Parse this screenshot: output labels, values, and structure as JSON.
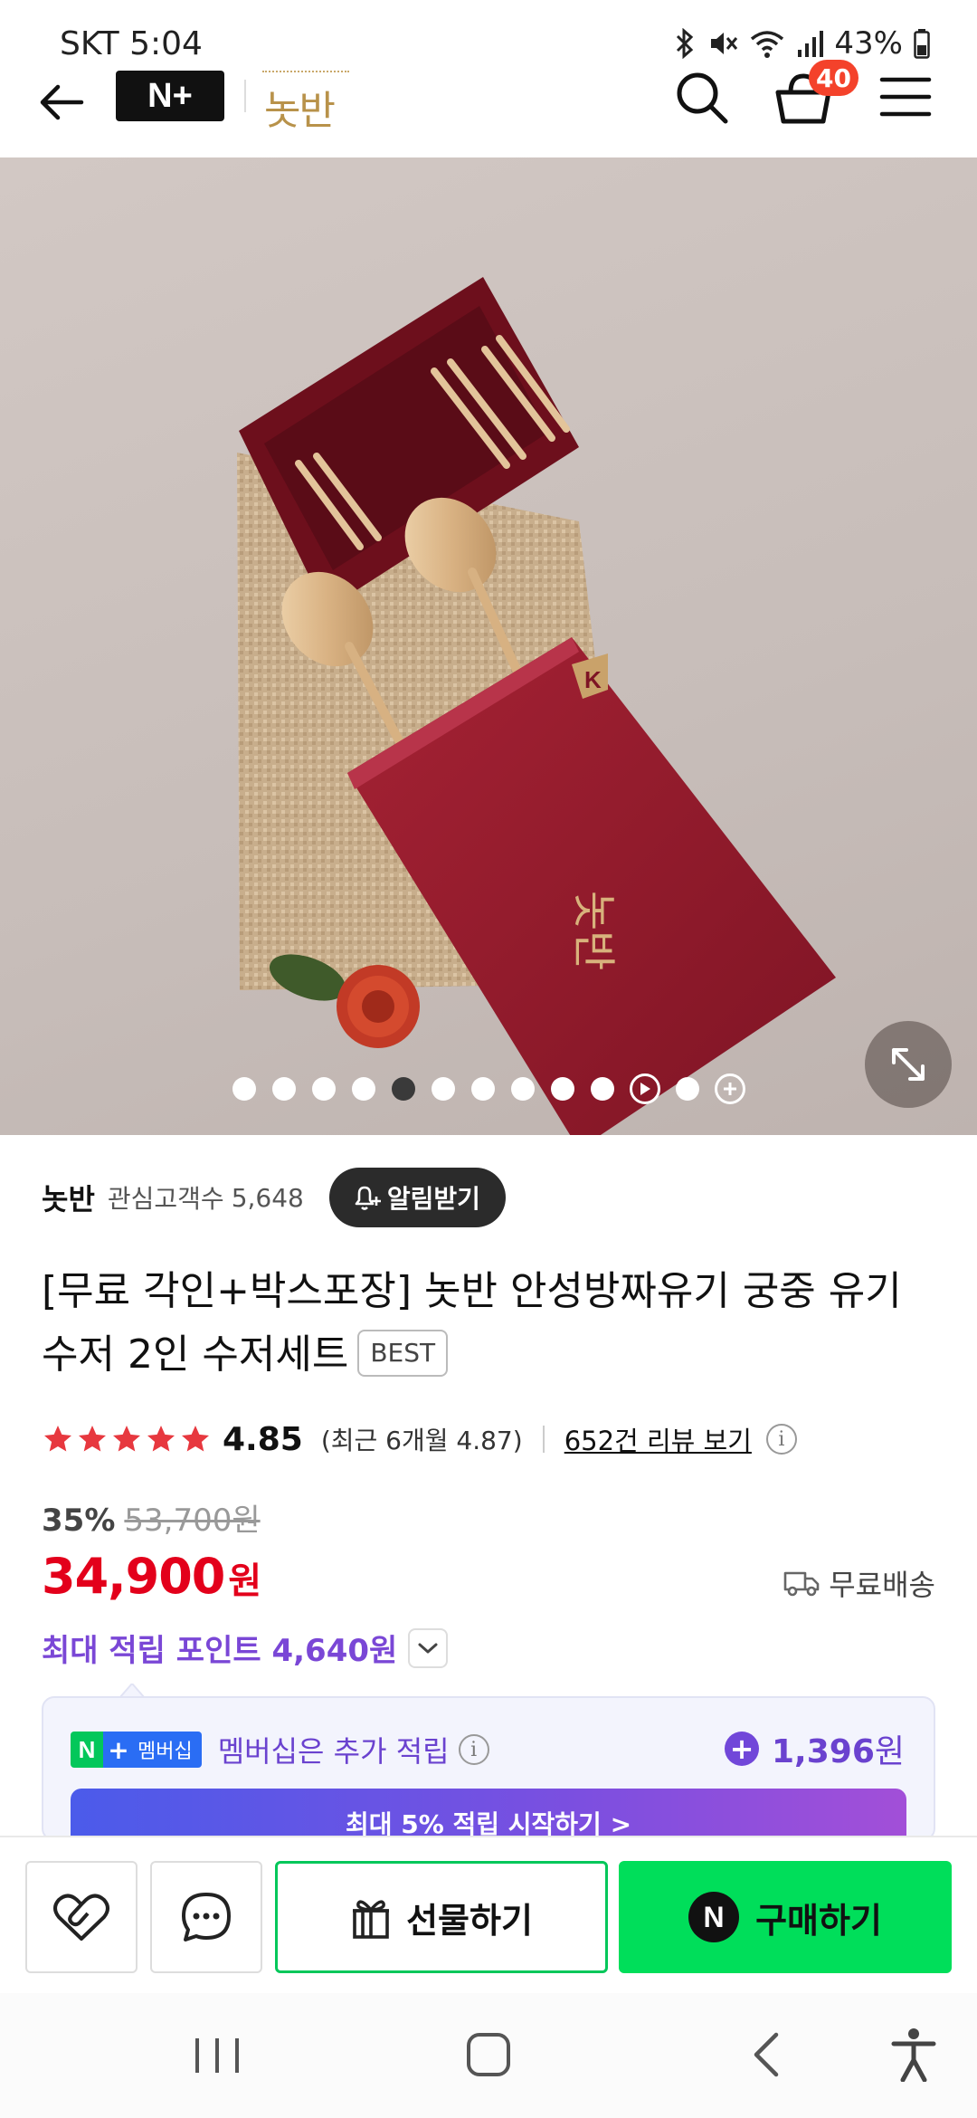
{
  "status_bar": {
    "carrier_time": "SKT 5:04",
    "battery": "43%"
  },
  "header": {
    "platform_logo": "N+",
    "brand_logo_text": "놋반",
    "cart_count": "40"
  },
  "hero": {
    "image_count": 12,
    "active_index": 4,
    "box_brand_text": "놋반"
  },
  "store": {
    "name": "놋반",
    "fan_label": "관심고객수",
    "fan_count": "5,648",
    "alarm_button": "알림받기"
  },
  "product": {
    "title": "[무료 각인+박스포장] 놋반 안성방짜유기 궁중 유기 수저 2인 수저세트",
    "badge": "BEST",
    "rating": "4.85",
    "recent_rating": "(최근 6개월 4.87)",
    "review_link": "652건 리뷰 보기",
    "stars": 5
  },
  "price": {
    "discount_rate": "35%",
    "original_price": "53,700원",
    "sale_price": "34,900",
    "sale_unit": "원",
    "shipping": "무료배송",
    "max_points": "최대 적립 포인트 4,640원"
  },
  "membership": {
    "badge_text": "멤버십",
    "label": "멤버십은 추가 적립",
    "amount_value": "1,396",
    "amount_unit": "원",
    "cta": "최대 5% 적립 시작하기 >"
  },
  "actions": {
    "gift": "선물하기",
    "buy": "구매하기",
    "buy_icon_letter": "N"
  },
  "colors": {
    "accent_green": "#03c75a",
    "price_red": "#e3001b",
    "points_purple": "#7a47d6",
    "star_red": "#e7383f"
  }
}
